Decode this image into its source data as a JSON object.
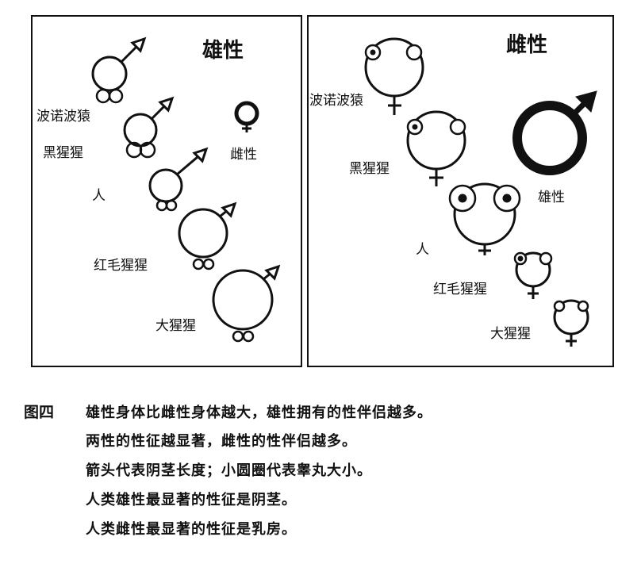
{
  "male_panel": {
    "title": "雄性",
    "species": [
      "波诺波猿",
      "黑猩猩",
      "人",
      "红毛猩猩",
      "大猩猩"
    ],
    "female_label": "雌性"
  },
  "female_panel": {
    "title": "雌性",
    "species": [
      "波诺波猿",
      "黑猩猩",
      "人",
      "红毛猩猩",
      "大猩猩"
    ],
    "male_label": "雄性"
  },
  "caption": {
    "figure_label": "图四",
    "lines": [
      "雄性身体比雌性身体越大，雄性拥有的性伴侣越多。",
      "两性的性征越显著，雌性的性伴侣越多。",
      "箭头代表阴茎长度；小圆圈代表睾丸大小。",
      "人类雄性最显著的性征是阴茎。",
      "人类雌性最显著的性征是乳房。"
    ]
  },
  "colors": {
    "ink": "#111111",
    "background": "#ffffff"
  }
}
